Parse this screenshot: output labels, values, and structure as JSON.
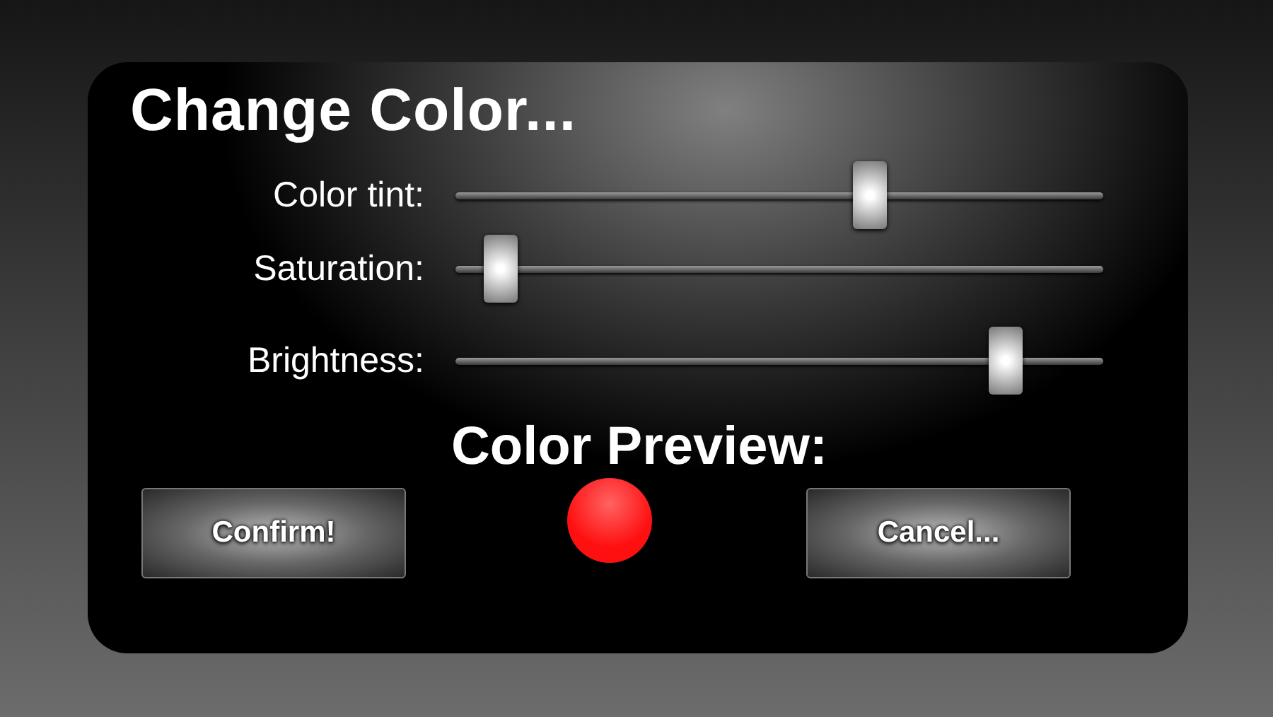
{
  "dialog": {
    "title": "Change Color..."
  },
  "sliders": [
    {
      "label": "Color tint:",
      "level": 0.64
    },
    {
      "label": "Saturation:",
      "level": 0.07
    },
    {
      "label": "Brightness:",
      "level": 0.85
    }
  ],
  "preview": {
    "label": "Color Preview:",
    "color": "#ff1010"
  },
  "buttons": [
    "Confirm!",
    "Cancel..."
  ]
}
